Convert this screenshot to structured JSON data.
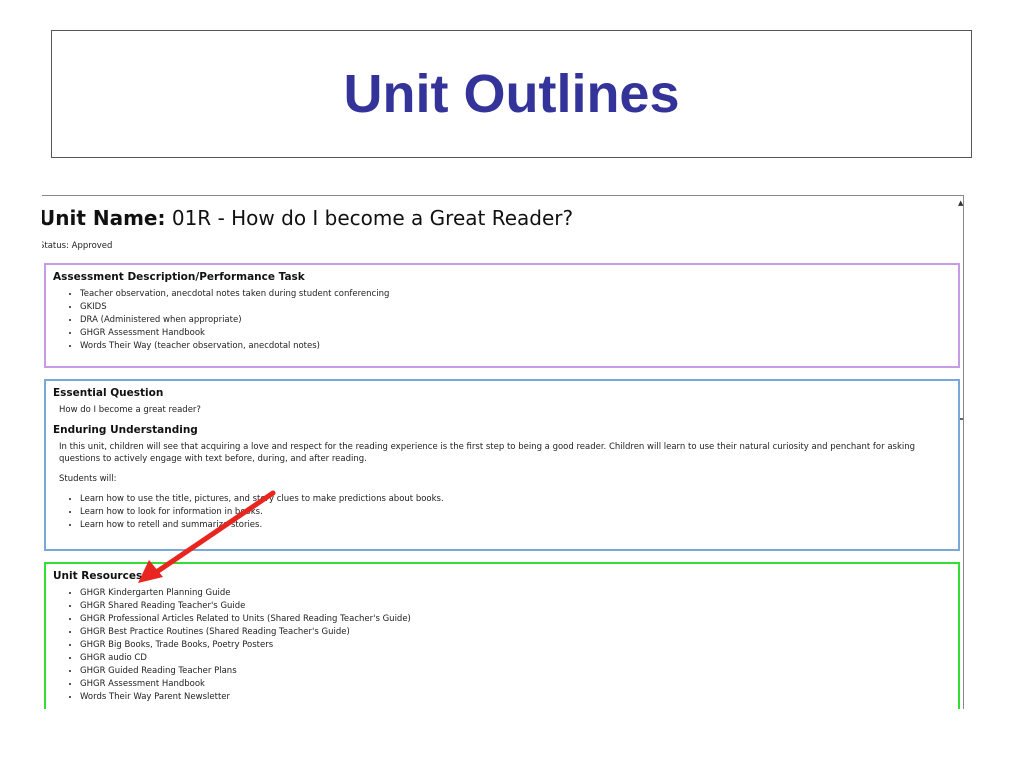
{
  "slide": {
    "title": "Unit Outlines"
  },
  "unit": {
    "label": "Unit Name:",
    "name": "01R - How do I become a Great Reader?",
    "status": "Status: Approved"
  },
  "assessment": {
    "header": "Assessment Description/Performance Task",
    "items": [
      "Teacher observation, anecdotal notes taken during student conferencing",
      "GKIDS",
      "DRA (Administered when appropriate)",
      "GHGR Assessment Handbook",
      "Words Their Way (teacher observation, anecdotal notes)"
    ]
  },
  "essential": {
    "header": "Essential Question",
    "question": "How do I become a great reader?",
    "enduring_header": "Enduring Understanding",
    "enduring_text": "In this unit, children will see that acquiring a love and respect for the reading experience is the first step to being a good reader.  Children will learn to use their natural curiosity and penchant for asking questions to actively engage with text before, during, and after reading.",
    "students_will": "Students will:",
    "items": [
      "Learn how to use the title, pictures, and story clues to make predictions about books.",
      "Learn how to look for information in books.",
      "Learn how to retell and summarize stories."
    ]
  },
  "resources": {
    "header": "Unit Resources",
    "items": [
      "GHGR Kindergarten Planning Guide",
      "GHGR Shared Reading Teacher's Guide",
      "GHGR Professional Articles Related to Units (Shared Reading Teacher's Guide)",
      "GHGR Best Practice Routines (Shared Reading Teacher's Guide)",
      "GHGR Big Books, Trade Books, Poetry Posters",
      "GHGR audio CD",
      "GHGR Guided Reading Teacher Plans",
      "GHGR Assessment Handbook",
      "Words Their Way Parent Newsletter"
    ]
  },
  "colors": {
    "title": "#33339a",
    "assessment_border": "#c89be8",
    "essential_border": "#7aa8d8",
    "resources_border": "#33dd33",
    "arrow": "#e8251f"
  },
  "icons": {
    "scroll_up": "scroll-up-arrow-icon",
    "annotation": "red-arrow-icon"
  }
}
